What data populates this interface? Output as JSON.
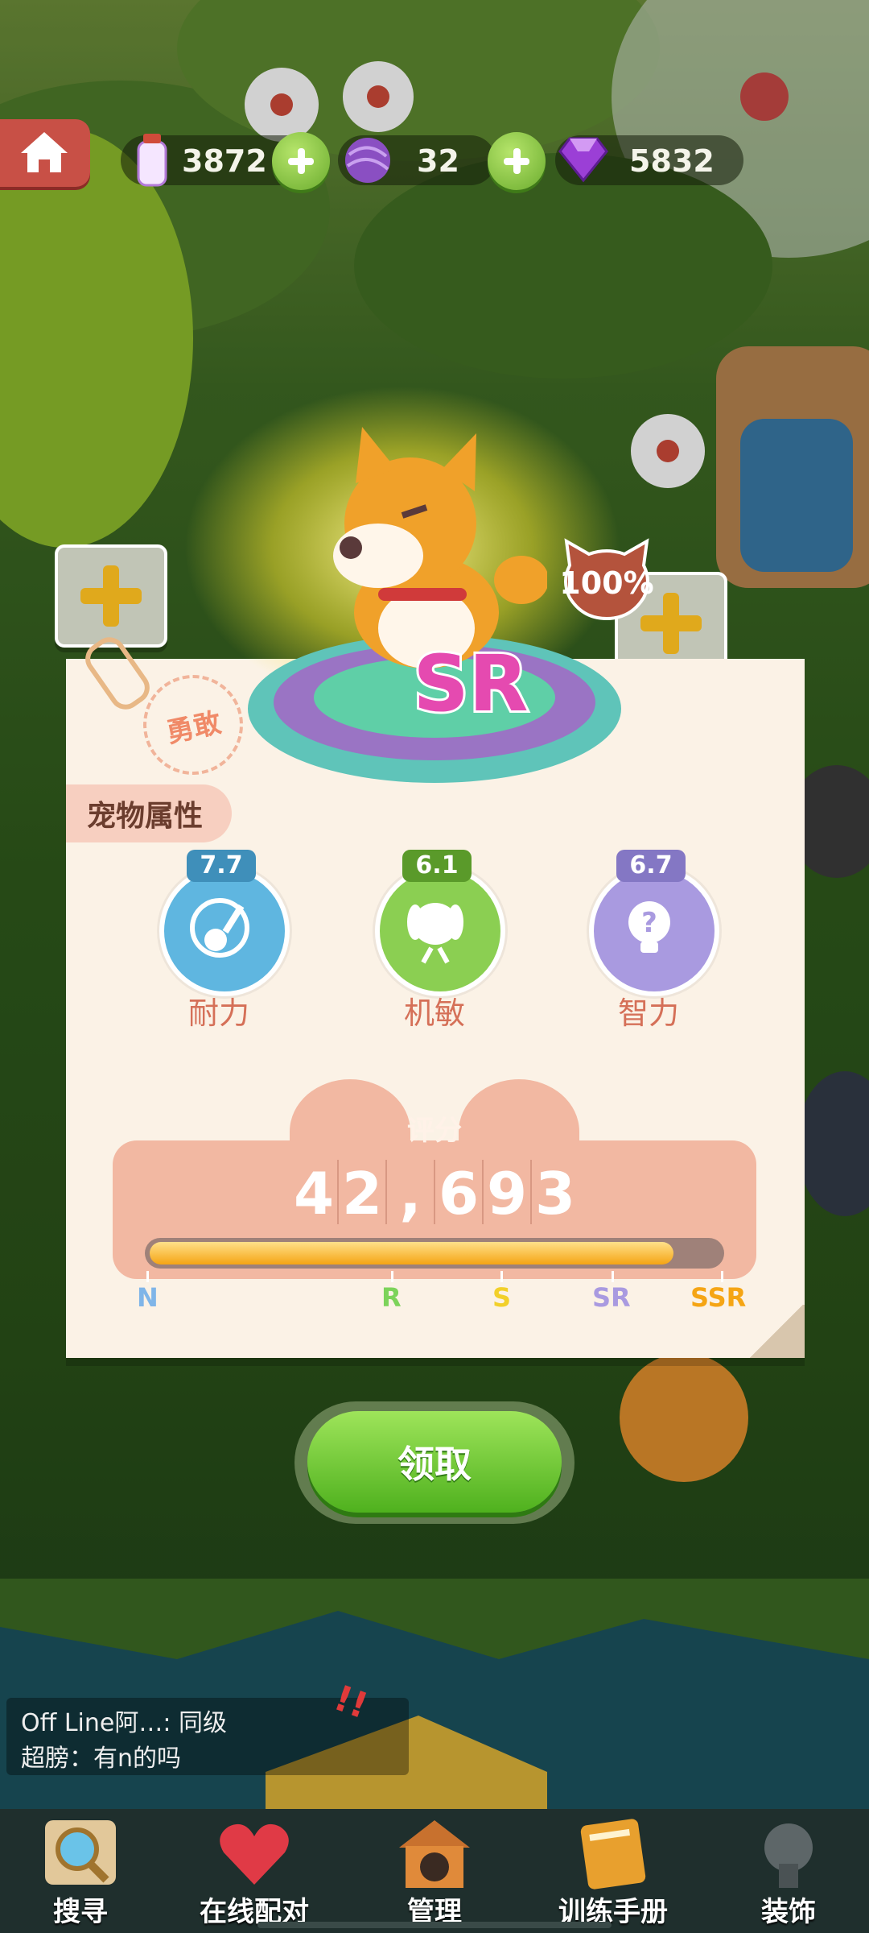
{
  "top_bar": {
    "resource1": "3872",
    "resource2": "32",
    "resource3": "5832"
  },
  "pet": {
    "rarity": "SR",
    "progress_badge": "100%",
    "trait_stamp": "勇敢"
  },
  "card": {
    "section_title": "宠物属性",
    "stats": [
      {
        "value": "7.7",
        "label": "耐力",
        "color": "#5fb6e0"
      },
      {
        "value": "6.1",
        "label": "机敏",
        "color": "#8bcf52"
      },
      {
        "value": "6.7",
        "label": "智力",
        "color": "#a99ae0"
      }
    ],
    "score_label": "评分",
    "score_digits": [
      "4",
      "2",
      ",",
      "6",
      "9",
      "3"
    ],
    "score_progress": 0.92,
    "grades": [
      {
        "text": "N",
        "color": "#7fb5e8"
      },
      {
        "text": "R",
        "color": "#7cd35a"
      },
      {
        "text": "S",
        "color": "#f2d02a"
      },
      {
        "text": "SR",
        "color": "#a99ae0"
      },
      {
        "text": "SSR",
        "color": "#f5a514"
      }
    ]
  },
  "claim_button": "领取",
  "chat": [
    "Off Line阿…: 同级",
    "超膀：有n的吗"
  ],
  "nav": [
    {
      "label": "搜寻",
      "icon": "magnifier-icon"
    },
    {
      "label": "在线配对",
      "icon": "heart-icon"
    },
    {
      "label": "管理",
      "icon": "doghouse-icon"
    },
    {
      "label": "训练手册",
      "icon": "book-icon"
    },
    {
      "label": "装饰",
      "icon": "decoration-icon"
    }
  ]
}
